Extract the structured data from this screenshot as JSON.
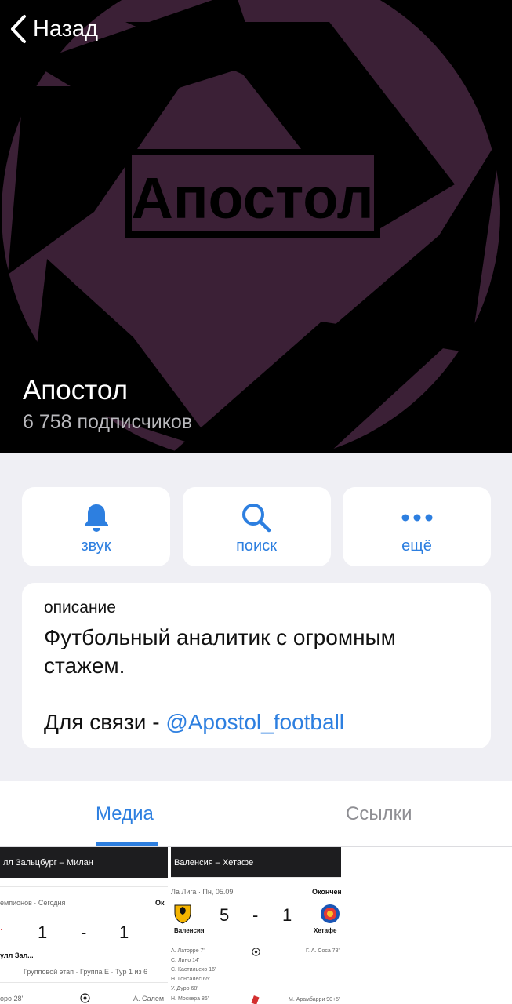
{
  "nav": {
    "back_label": "Назад"
  },
  "channel": {
    "logo_text": "Апостол",
    "name": "Апостол",
    "subscribers": "6 758 подписчиков"
  },
  "actions": [
    {
      "label": "звук",
      "icon": "bell-icon"
    },
    {
      "label": "поиск",
      "icon": "search-icon"
    },
    {
      "label": "ещё",
      "icon": "more-icon"
    }
  ],
  "description": {
    "caption": "описание",
    "text": "Футбольный аналитик с огромным стажем.",
    "contact_prefix": "Для связи - ",
    "contact_link": "@Apostol_football"
  },
  "tabs": {
    "media": "Медиа",
    "links": "Ссылки"
  },
  "media": [
    {
      "header": "лл Зальцбург – Милан",
      "league": "емпионов · Сегодня",
      "status": "Ок",
      "score_home": "1",
      "score_sep": "-",
      "score_away": "1",
      "team": "улл Зал...",
      "stage": "Групповой этап · Группа E · Тур 1 из 6",
      "event_left": "оро 28'",
      "event_right": "А. Салем"
    },
    {
      "header": "Валенсия – Хетафе",
      "league": "Ла Лига · Пн, 05.09",
      "status": "Окончен",
      "score_home": "5",
      "score_sep": "-",
      "score_away": "1",
      "team_home": "Валенсия",
      "team_away": "Хетафе",
      "scorers_home": [
        "А. Латорре 7'",
        "С. Лино 14'",
        "С. Кастильехо 16'",
        "Н. Гонсалес 65'",
        "У. Дуро 68'",
        "Н. Москера 86'"
      ],
      "scorer_away": "Г. А. Соса 78'",
      "event_right": "М. Арамбарри 90+5'"
    }
  ],
  "colors": {
    "accent": "#2d7fe0",
    "logo": "#3b2036",
    "background": "#efeff4"
  }
}
